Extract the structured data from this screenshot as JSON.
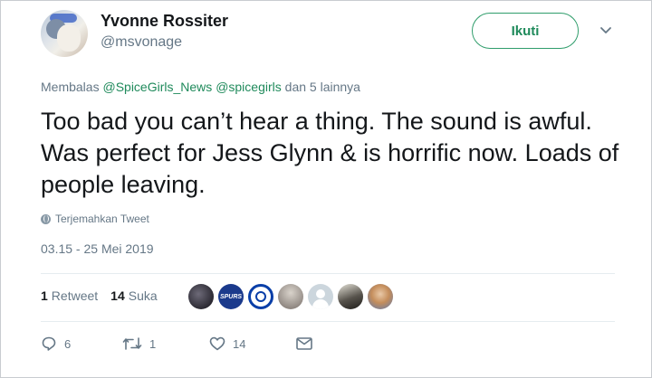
{
  "user": {
    "name": "Yvonne Rossiter",
    "handle": "@msvonage"
  },
  "follow_label": "Ikuti",
  "reply_to": {
    "prefix": "Membalas",
    "mention1": "@SpiceGirls_News",
    "mention2": "@spicegirls",
    "suffix": "dan 5 lainnya"
  },
  "tweet_text": "Too bad you can’t hear a thing. The sound is awful. Was perfect for Jess Glynn & is horrific now. Loads of people leaving.",
  "translate_label": "Terjemahkan Tweet",
  "timestamp": "03.15 - 25 Mei 2019",
  "stats": {
    "retweets_count": "1",
    "retweets_label": "Retweet",
    "likes_count": "14",
    "likes_label": "Suka"
  },
  "actions": {
    "replies": "6",
    "retweets": "1",
    "likes": "14"
  },
  "colors": {
    "accent": "#1f8a5b",
    "muted": "#657786"
  },
  "liker_avatars": [
    {
      "icon": "avatar-photo-icon"
    },
    {
      "icon": "spurs-logo-icon",
      "text": "SPURS"
    },
    {
      "icon": "chelsea-logo-icon"
    },
    {
      "icon": "avatar-photo-icon"
    },
    {
      "icon": "default-avatar-icon"
    },
    {
      "icon": "avatar-photo-icon"
    },
    {
      "icon": "avatar-photo-icon"
    }
  ]
}
